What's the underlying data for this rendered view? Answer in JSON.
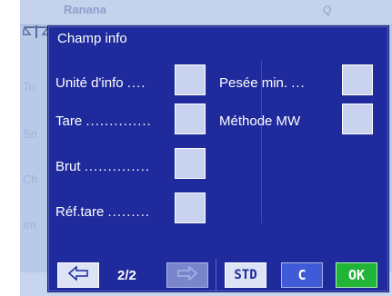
{
  "background": {
    "title": "Ranana",
    "right_label": "Q",
    "items": [
      "To",
      "Sn",
      "Ch",
      "Im"
    ]
  },
  "dialog": {
    "title": "Champ info",
    "left_rows": [
      {
        "label": "Unité d'info",
        "dots": "...."
      },
      {
        "label": "Tare",
        "dots": ".............."
      },
      {
        "label": "Brut",
        "dots": ".............."
      },
      {
        "label": "Réf.tare",
        "dots": "........."
      }
    ],
    "right_rows": [
      {
        "label": "Pesée min.",
        "dots": "..."
      },
      {
        "label": "Méthode MW",
        "dots": ""
      }
    ]
  },
  "toolbar": {
    "back_icon": "arrow-left-icon",
    "page": "2/2",
    "forward_icon": "arrow-right-icon",
    "std_label": "STD",
    "c_label": "C",
    "ok_label": "OK"
  },
  "colors": {
    "dialog_bg": "#1f2a9c",
    "checkbox_bg": "#c9d2ee",
    "ok_bg": "#22b436",
    "c_bg": "#3f5bd8"
  }
}
